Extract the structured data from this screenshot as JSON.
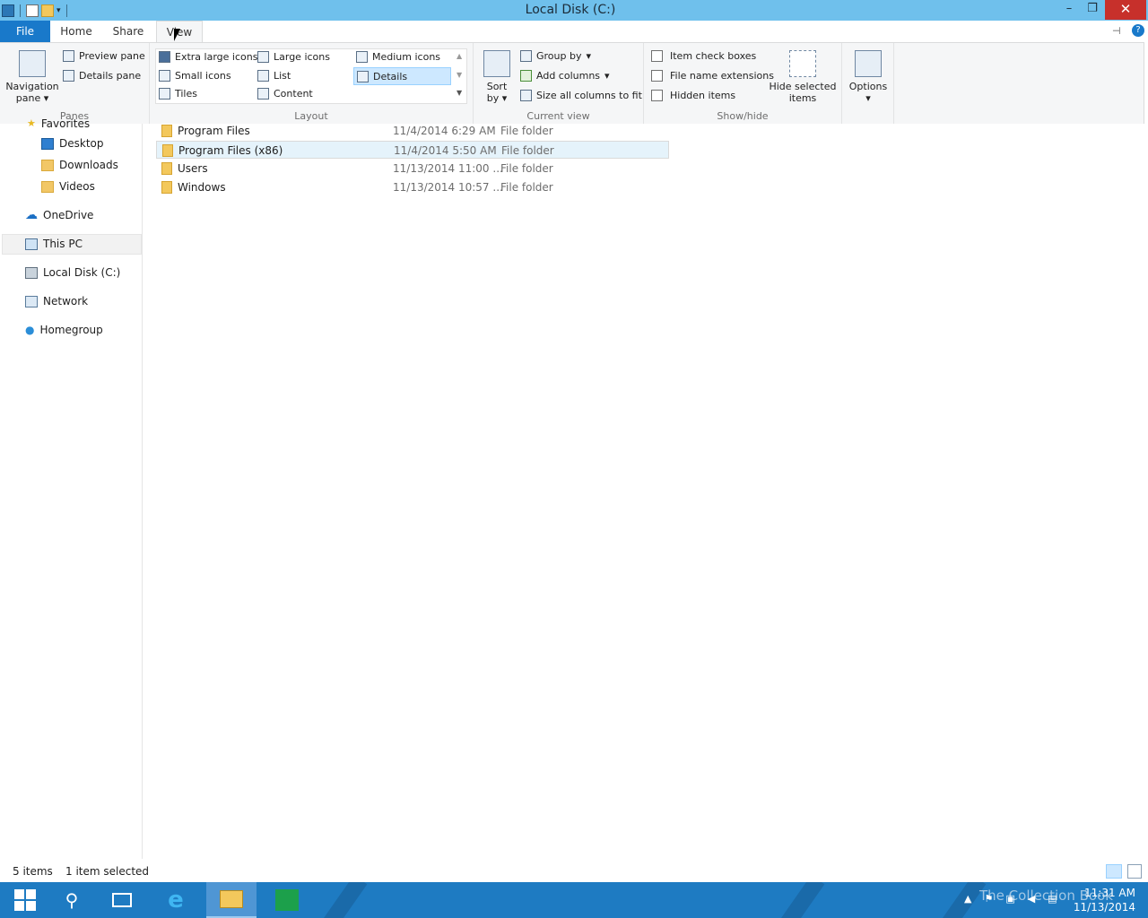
{
  "window": {
    "title": "Local Disk (C:)",
    "minimize": "–",
    "maximize": "❐",
    "close": "✕"
  },
  "tabs": {
    "file": "File",
    "home": "Home",
    "share": "Share",
    "view": "View"
  },
  "ribbon": {
    "panes": {
      "label": "Panes",
      "navigation_pane_line1": "Navigation",
      "navigation_pane_line2": "pane",
      "preview_pane": "Preview pane",
      "details_pane": "Details pane"
    },
    "layout": {
      "label": "Layout",
      "extra_large_icons": "Extra large icons",
      "large_icons": "Large icons",
      "medium_icons": "Medium icons",
      "small_icons": "Small icons",
      "list": "List",
      "details": "Details",
      "tiles": "Tiles",
      "content": "Content"
    },
    "current_view": {
      "label": "Current view",
      "sort_by_line1": "Sort",
      "sort_by_line2": "by",
      "group_by": "Group by",
      "add_columns": "Add columns",
      "size_all_columns": "Size all columns to fit"
    },
    "show_hide": {
      "label": "Show/hide",
      "item_check_boxes": "Item check boxes",
      "file_name_extensions": "File name extensions",
      "hidden_items": "Hidden items",
      "hide_selected_line1": "Hide selected",
      "hide_selected_line2": "items"
    },
    "options": {
      "label": "Options"
    }
  },
  "nav": {
    "favorites": "Favorites",
    "desktop": "Desktop",
    "downloads": "Downloads",
    "videos": "Videos",
    "onedrive": "OneDrive",
    "this_pc": "This PC",
    "local_disk": "Local Disk (C:)",
    "network": "Network",
    "homegroup": "Homegroup"
  },
  "files": [
    {
      "name": "Program Files",
      "date": "11/4/2014 6:29 AM",
      "type": "File folder"
    },
    {
      "name": "Program Files (x86)",
      "date": "11/4/2014 5:50 AM",
      "type": "File folder"
    },
    {
      "name": "Users",
      "date": "11/13/2014 11:00 ...",
      "type": "File folder"
    },
    {
      "name": "Windows",
      "date": "11/13/2014 10:57 ...",
      "type": "File folder"
    }
  ],
  "status": {
    "items": "5 items",
    "selected": "1 item selected"
  },
  "taskbar": {
    "time": "11:31 AM",
    "date": "11/13/2014",
    "watermark": "The Collection Book"
  },
  "colors": {
    "titlebar": "#6fc0ec",
    "file_tab": "#1979ca",
    "taskbar": "#1e7bc2",
    "selection": "#e5f3fb",
    "close": "#c7302b"
  }
}
